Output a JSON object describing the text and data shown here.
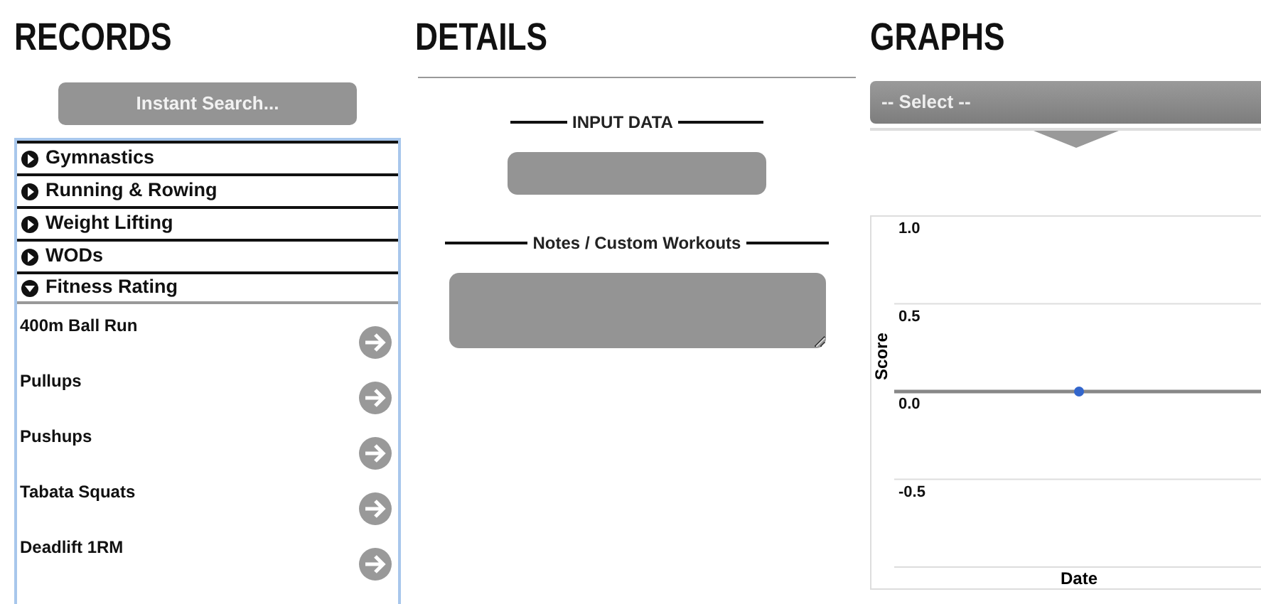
{
  "records": {
    "title": "RECORDS",
    "search": {
      "label": "Instant Search..."
    },
    "categories": [
      {
        "label": "Gymnastics",
        "expanded": false
      },
      {
        "label": "Running & Rowing",
        "expanded": false
      },
      {
        "label": "Weight Lifting",
        "expanded": false
      },
      {
        "label": "WODs",
        "expanded": false
      },
      {
        "label": "Fitness Rating",
        "expanded": true,
        "items": [
          "400m Ball Run",
          "Pullups",
          "Pushups",
          "Tabata Squats",
          "Deadlift 1RM"
        ]
      }
    ]
  },
  "details": {
    "title": "DETAILS",
    "input_heading": "INPUT DATA",
    "notes_heading": "Notes / Custom Workouts"
  },
  "graphs": {
    "title": "GRAPHS",
    "select": {
      "value": "-- Select --"
    },
    "chart_data": {
      "type": "scatter",
      "xlabel": "Date",
      "ylabel": "Score",
      "ylim": [
        -1,
        1
      ],
      "yticks": [
        {
          "value": 1,
          "label": "1.0"
        },
        {
          "value": 0.5,
          "label": "0.5"
        },
        {
          "value": 0,
          "label": "0.0"
        },
        {
          "value": -0.5,
          "label": "-0.5"
        }
      ],
      "series": [
        {
          "color": "#3366cc",
          "values": [
            0.0
          ]
        }
      ]
    }
  }
}
